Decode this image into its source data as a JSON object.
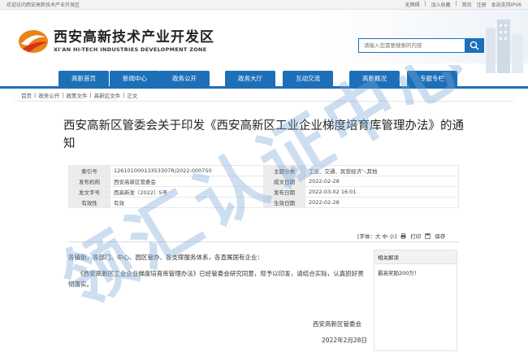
{
  "topbar": {
    "welcome": "欢迎访问西安高新技术产业开发区",
    "links": [
      "无障碍",
      "加入收藏",
      "首页",
      "注册",
      "本站支持IPV6"
    ]
  },
  "logo": {
    "cn": "西安高新技术产业开发区",
    "en": "XI'AN HI-TECH INDUSTRIES DEVELOPMENT ZONE"
  },
  "search": {
    "placeholder": "请输入您需要搜索的内容"
  },
  "nav": [
    "高新首页",
    "新闻中心",
    "政务公开",
    "政务大厅",
    "互动交流",
    "高新概况",
    "专题专栏"
  ],
  "breadcrumb": [
    "首页",
    "政务公开",
    "政策文件",
    "高新区文件",
    "正文"
  ],
  "article": {
    "title": "西安高新区管委会关于印发《西安高新区工业企业梯度培育库管理办法》的通知",
    "meta": [
      {
        "l1": "索引号",
        "v1": "12610100013353307R/2022-000750",
        "l2": "主题分类",
        "v2": "工业、交通、民营经济＼其他"
      },
      {
        "l1": "发布机构",
        "v1": "西安高新区管委会",
        "l2": "成文日期",
        "v2": "2022-02-28"
      },
      {
        "l1": "发文字号",
        "v1": "西高新发〔2022〕5号",
        "l2": "发布日期",
        "v2": "2022-03-02 16:01"
      },
      {
        "l1": "有效性",
        "v1": "有效",
        "l2": "生效日期",
        "v2": "2022-02-28"
      }
    ],
    "font_label": "[字体：大 中 小]",
    "print_label": "打印",
    "save_label": "保存",
    "salutation": "各镇街，各部门、中心、园区管办、各支撑服务体系，各直属国有企业：",
    "paragraph": "《西安高新区工业企业梯度培育库管理办法》已经管委会研究同意，现予以印发，请结合实际，认真抓好贯彻落实。",
    "signer": "西安高新区管委会",
    "date": "2022年2月28日"
  },
  "sidebar": {
    "heading": "相关解读",
    "items": [
      "最高奖励200万！"
    ]
  },
  "watermark": {
    "text": "领汇认证中心"
  },
  "colors": {
    "primary": "#1d6fb8",
    "logo_orange": "#e8841a",
    "logo_red": "#d9301c"
  }
}
